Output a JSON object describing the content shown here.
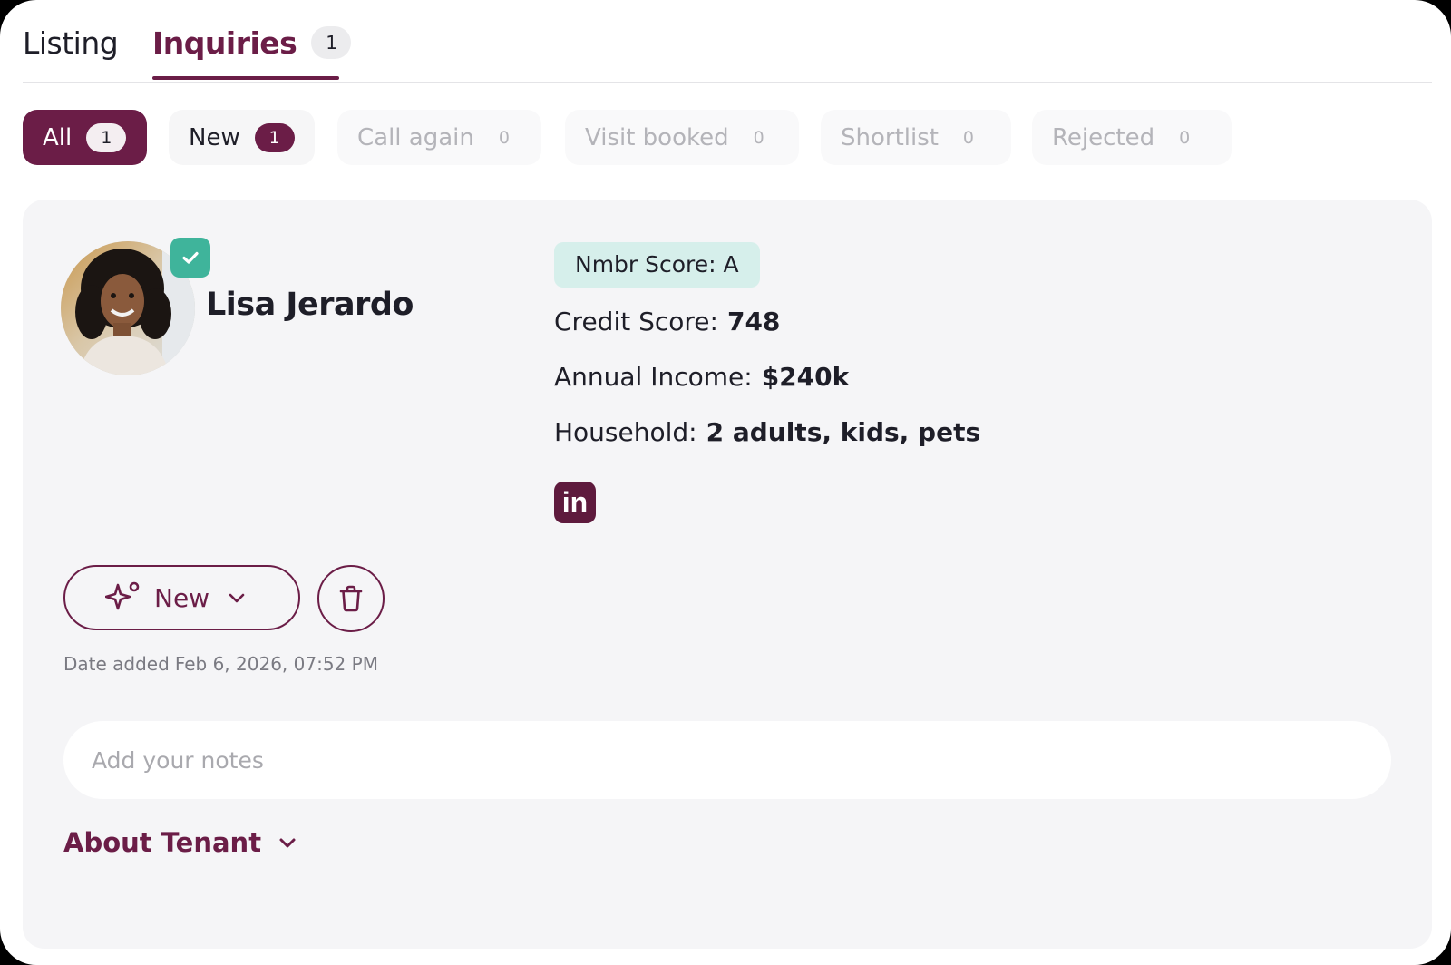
{
  "tabs": {
    "listing": "Listing",
    "inquiries": "Inquiries",
    "inquiries_count": "1"
  },
  "filters": [
    {
      "label": "All",
      "count": "1"
    },
    {
      "label": "New",
      "count": "1"
    },
    {
      "label": "Call again",
      "count": "0"
    },
    {
      "label": "Visit booked",
      "count": "0"
    },
    {
      "label": "Shortlist",
      "count": "0"
    },
    {
      "label": "Rejected",
      "count": "0"
    }
  ],
  "tenant": {
    "name": "Lisa Jerardo",
    "verified": true,
    "nmbr_score": "Nmbr Score: A",
    "credit_label": "Credit Score:",
    "credit_value": "748",
    "income_label": "Annual Income:",
    "income_value": "$240k",
    "household_label": "Household:",
    "household_value": "2 adults, kids, pets",
    "linkedin_text": "in"
  },
  "status": {
    "label": "New"
  },
  "date_added": {
    "label": "Date added",
    "value": "Feb 6, 2026, 07:52 PM"
  },
  "notes": {
    "placeholder": "Add your notes",
    "value": ""
  },
  "about": {
    "label": "About Tenant"
  },
  "colors": {
    "brand": "#6b1d47",
    "verified": "#3fb49b",
    "score_badge_bg": "#d6efeb"
  }
}
